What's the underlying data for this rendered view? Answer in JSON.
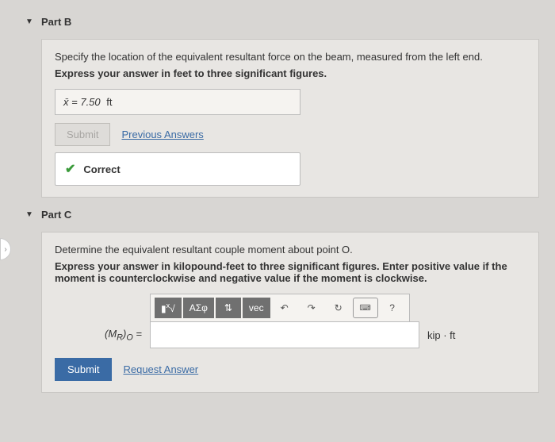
{
  "partB": {
    "title": "Part B",
    "instruction": "Specify the location of the equivalent resultant force on the beam, measured from the left end.",
    "expressHint": "Express your answer in feet to three significant figures.",
    "answer_var": "x̄ =",
    "answer_value": "7.50",
    "answer_unit": "ft",
    "submitLabel": "Submit",
    "prevAnswersLabel": "Previous Answers",
    "correctLabel": "Correct"
  },
  "partC": {
    "title": "Part C",
    "instruction": "Determine the equivalent resultant couple moment about point O.",
    "expressHint": "Express your answer in kilopound-feet to three significant figures. Enter positive value if the moment is counterclockwise and negative value if the moment is clockwise.",
    "toolbar": {
      "template": "√",
      "greek": "ΑΣφ",
      "updown": "⇅",
      "vec": "vec",
      "undo": "↶",
      "redo": "↷",
      "reset": "↻",
      "keyboard": "⌨",
      "help": "?"
    },
    "formulaLabel": "(M_R)_O =",
    "unitLabel": "kip · ft",
    "submitLabel": "Submit",
    "requestAnswerLabel": "Request Answer"
  },
  "nav": {
    "prevGlyph": "›"
  }
}
